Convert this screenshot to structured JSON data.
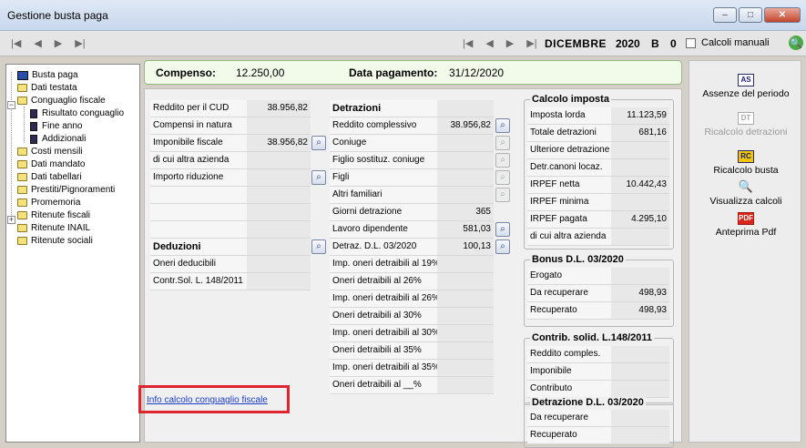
{
  "window": {
    "title": "Gestione busta paga",
    "controls": {
      "minimize": "–",
      "maximize": "□",
      "close": "✕"
    }
  },
  "navbar": {
    "first_left": "|◀",
    "prev_left": "◀",
    "next_left": "▶",
    "last_left": "▶|",
    "first_right": "|◀",
    "prev_right": "◀",
    "next_right": "▶",
    "last_right": "▶|",
    "month": "DICEMBRE",
    "year": "2020",
    "letter": "B",
    "number": "0",
    "manual_calc_label": "Calcoli manuali",
    "manual_calc_checked": false,
    "search_icon": "🔍"
  },
  "tree": {
    "items": [
      {
        "label": "Busta paga"
      },
      {
        "label": "Dati testata"
      },
      {
        "label": "Conguaglio fiscale"
      },
      {
        "label": "Risultato conguaglio"
      },
      {
        "label": "Fine anno"
      },
      {
        "label": "Addizionali"
      },
      {
        "label": "Costi mensili"
      },
      {
        "label": "Dati mandato"
      },
      {
        "label": "Dati tabellari"
      },
      {
        "label": "Prestiti/Pignoramenti"
      },
      {
        "label": "Promemoria"
      },
      {
        "label": "Ritenute fiscali"
      },
      {
        "label": "Ritenute INAIL"
      },
      {
        "label": "Ritenute sociali"
      }
    ],
    "expander_minus": "−",
    "expander_plus": "+"
  },
  "compenso": {
    "label": "Compenso:",
    "value": "12.250,00",
    "date_label": "Data pagamento:",
    "date_value": "31/12/2020"
  },
  "left_grid": {
    "rows": [
      {
        "label": "Reddito per il CUD",
        "value": "38.956,82"
      },
      {
        "label": "Compensi in natura",
        "value": ""
      },
      {
        "label": "Imponibile fiscale",
        "value": "38.956,82"
      },
      {
        "label": "di cui altra azienda",
        "value": ""
      },
      {
        "label": "Importo riduzione",
        "value": ""
      }
    ],
    "deduzioni_header": "Deduzioni",
    "deduzioni_rows": [
      {
        "label": "Oneri deducibili",
        "value": ""
      },
      {
        "label": "Contr.Sol. L. 148/2011",
        "value": ""
      }
    ]
  },
  "detrazioni": {
    "header": "Detrazioni",
    "rows": [
      {
        "label": "Reddito complessivo",
        "value": "38.956,82"
      },
      {
        "label": "Coniuge",
        "value": ""
      },
      {
        "label": "Figlio sostituz. coniuge",
        "value": ""
      },
      {
        "label": "Figli",
        "value": ""
      },
      {
        "label": "Altri familiari",
        "value": ""
      },
      {
        "label": "Giorni detrazione",
        "value": "365"
      },
      {
        "label": "Lavoro dipendente",
        "value": "581,03"
      },
      {
        "label": "Detraz. D.L. 03/2020",
        "value": "100,13"
      },
      {
        "label": "Imp. oneri detraibili al 19%",
        "value": ""
      },
      {
        "label": "Oneri detraibili al 26%",
        "value": ""
      },
      {
        "label": "Imp. oneri detraibili al 26%",
        "value": ""
      },
      {
        "label": "Oneri detraibili al 30%",
        "value": ""
      },
      {
        "label": "Imp. oneri detraibili al 30%",
        "value": ""
      },
      {
        "label": "Oneri detraibili al 35%",
        "value": ""
      },
      {
        "label": "Imp. oneri detraibili al 35%",
        "value": ""
      },
      {
        "label": "Oneri detraibili al __%",
        "value": ""
      }
    ]
  },
  "calcolo_imposta": {
    "title": "Calcolo imposta",
    "rows": [
      {
        "label": "Imposta lorda",
        "value": "11.123,59"
      },
      {
        "label": "Totale detrazioni",
        "value": "681,16"
      },
      {
        "label": "Ulteriore detrazione",
        "value": ""
      },
      {
        "label": "Detr.canoni locaz.",
        "value": ""
      },
      {
        "label": "IRPEF netta",
        "value": "10.442,43"
      },
      {
        "label": "IRPEF minima",
        "value": ""
      },
      {
        "label": "IRPEF pagata",
        "value": "4.295,10"
      },
      {
        "label": "di cui altra azienda",
        "value": ""
      }
    ]
  },
  "bonus": {
    "title": "Bonus D.L. 03/2020",
    "rows": [
      {
        "label": "Erogato",
        "value": ""
      },
      {
        "label": "Da recuperare",
        "value": "498,93"
      },
      {
        "label": "Recuperato",
        "value": "498,93"
      }
    ]
  },
  "contrib": {
    "title": "Contrib. solid. L.148/2011",
    "rows": [
      {
        "label": "Reddito comples.",
        "value": ""
      },
      {
        "label": "Imponibile",
        "value": ""
      },
      {
        "label": "Contributo",
        "value": ""
      }
    ]
  },
  "detrazione_dl": {
    "title": "Detrazione D.L. 03/2020",
    "rows": [
      {
        "label": "Da recuperare",
        "value": ""
      },
      {
        "label": "Recuperato",
        "value": ""
      }
    ]
  },
  "info_link": "Info calcolo conguaglio fiscale",
  "actions": {
    "assenze": {
      "icon": "AS",
      "label": "Assenze del periodo"
    },
    "ricalcolo_detrazioni": {
      "icon": "DT",
      "label": "Ricalcolo detrazioni"
    },
    "ricalcolo_busta": {
      "icon": "RC",
      "label": "Ricalcolo busta"
    },
    "visualizza": {
      "icon": "🔍",
      "label": "Visualizza calcoli"
    },
    "anteprima": {
      "icon": "PDF",
      "label": "Anteprima Pdf"
    }
  },
  "icons": {
    "lens": "⌕"
  }
}
